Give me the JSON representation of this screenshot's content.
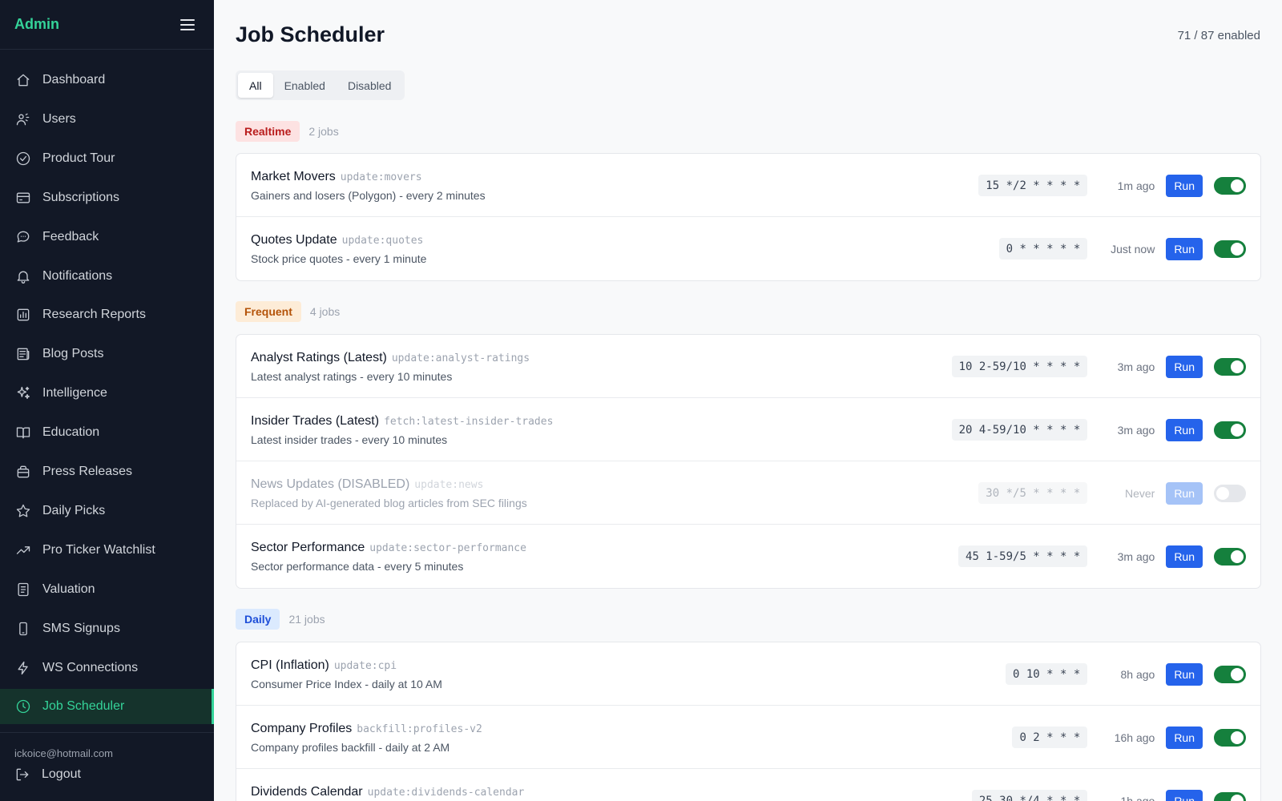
{
  "sidebar": {
    "brand": "Admin",
    "items": [
      {
        "label": "Dashboard",
        "icon": "home-icon"
      },
      {
        "label": "Users",
        "icon": "users-icon"
      },
      {
        "label": "Product Tour",
        "icon": "check-circle-icon"
      },
      {
        "label": "Subscriptions",
        "icon": "credit-card-icon"
      },
      {
        "label": "Feedback",
        "icon": "chat-bubble-icon"
      },
      {
        "label": "Notifications",
        "icon": "bell-icon"
      },
      {
        "label": "Research Reports",
        "icon": "bar-chart-icon"
      },
      {
        "label": "Blog Posts",
        "icon": "newspaper-icon"
      },
      {
        "label": "Intelligence",
        "icon": "sparkles-icon"
      },
      {
        "label": "Education",
        "icon": "book-open-icon"
      },
      {
        "label": "Press Releases",
        "icon": "briefcase-icon"
      },
      {
        "label": "Daily Picks",
        "icon": "star-icon"
      },
      {
        "label": "Pro Ticker Watchlist",
        "icon": "trending-up-icon"
      },
      {
        "label": "Valuation",
        "icon": "document-icon"
      },
      {
        "label": "SMS Signups",
        "icon": "phone-icon"
      },
      {
        "label": "WS Connections",
        "icon": "bolt-icon"
      },
      {
        "label": "Job Scheduler",
        "icon": "clock-icon",
        "active": true
      }
    ],
    "email": "ickoice@hotmail.com",
    "logout_label": "Logout"
  },
  "header": {
    "title": "Job Scheduler",
    "enabled_count": "71 / 87 enabled"
  },
  "tabs": [
    {
      "label": "All",
      "active": true
    },
    {
      "label": "Enabled"
    },
    {
      "label": "Disabled"
    }
  ],
  "run_label": "Run",
  "colors": {
    "accent": "#34d399",
    "run_button": "#2563eb",
    "toggle_on": "#15803d",
    "sidebar_bg": "#121826"
  },
  "groups": [
    {
      "label": "Realtime",
      "count": "2 jobs",
      "badge_bg": "#fde2e2",
      "badge_color": "#b91c1c",
      "jobs": [
        {
          "name": "Market Movers",
          "cmd": "update:movers",
          "desc": "Gainers and losers (Polygon) - every 2 minutes",
          "cron": "15 */2 * * * *",
          "ago": "1m ago",
          "enabled": true
        },
        {
          "name": "Quotes Update",
          "cmd": "update:quotes",
          "desc": "Stock price quotes - every 1 minute",
          "cron": "0 * * * * *",
          "ago": "Just now",
          "enabled": true
        }
      ]
    },
    {
      "label": "Frequent",
      "count": "4 jobs",
      "badge_bg": "#fdecd7",
      "badge_color": "#b45309",
      "jobs": [
        {
          "name": "Analyst Ratings (Latest)",
          "cmd": "update:analyst-ratings",
          "desc": "Latest analyst ratings - every 10 minutes",
          "cron": "10 2-59/10 * * * *",
          "ago": "3m ago",
          "enabled": true
        },
        {
          "name": "Insider Trades (Latest)",
          "cmd": "fetch:latest-insider-trades",
          "desc": "Latest insider trades - every 10 minutes",
          "cron": "20 4-59/10 * * * *",
          "ago": "3m ago",
          "enabled": true
        },
        {
          "name": "News Updates (DISABLED)",
          "cmd": "update:news",
          "desc": "Replaced by AI-generated blog articles from SEC filings",
          "cron": "30 */5 * * * *",
          "ago": "Never",
          "enabled": false
        },
        {
          "name": "Sector Performance",
          "cmd": "update:sector-performance",
          "desc": "Sector performance data - every 5 minutes",
          "cron": "45 1-59/5 * * * *",
          "ago": "3m ago",
          "enabled": true
        }
      ]
    },
    {
      "label": "Daily",
      "count": "21 jobs",
      "badge_bg": "#dbeafe",
      "badge_color": "#1d4ed8",
      "jobs": [
        {
          "name": "CPI (Inflation)",
          "cmd": "update:cpi",
          "desc": "Consumer Price Index - daily at 10 AM",
          "cron": "0 10 * * *",
          "ago": "8h ago",
          "enabled": true
        },
        {
          "name": "Company Profiles",
          "cmd": "backfill:profiles-v2",
          "desc": "Company profiles backfill - daily at 2 AM",
          "cron": "0 2 * * *",
          "ago": "16h ago",
          "enabled": true
        },
        {
          "name": "Dividends Calendar",
          "cmd": "update:dividends-calendar",
          "desc": "",
          "cron": "25 30 */4 * * *",
          "ago": "1h ago",
          "enabled": true
        }
      ]
    }
  ]
}
